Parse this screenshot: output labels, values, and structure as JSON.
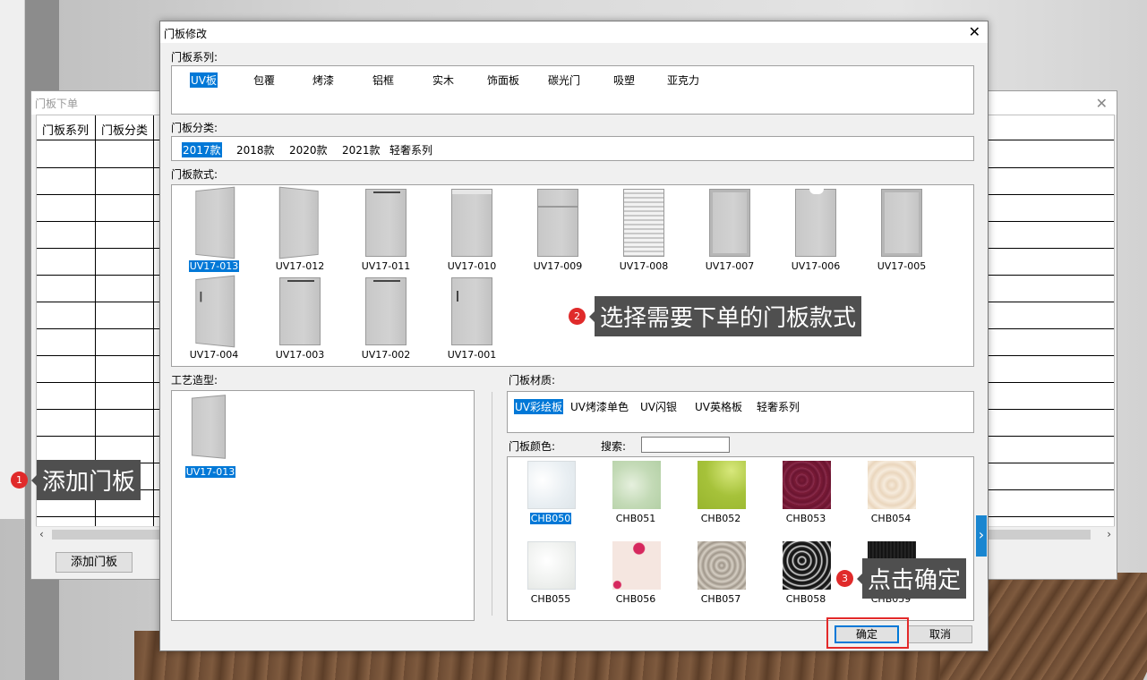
{
  "order_window": {
    "title": "门板下单",
    "columns": [
      "门板系列",
      "门板分类"
    ],
    "add_button": "添加门板"
  },
  "dialog": {
    "title": "门板修改",
    "series_label": "门板系列:",
    "series": [
      "UV板",
      "包覆",
      "烤漆",
      "铝框",
      "实木",
      "饰面板",
      "碳光门",
      "吸塑",
      "亚克力"
    ],
    "category_label": "门板分类:",
    "categories": [
      "2017款",
      "2018款",
      "2020款",
      "2021款",
      "轻奢系列"
    ],
    "style_label": "门板款式:",
    "styles": [
      "UV17-013",
      "UV17-012",
      "UV17-011",
      "UV17-010",
      "UV17-009",
      "UV17-008",
      "UV17-007",
      "UV17-006",
      "UV17-005",
      "UV17-004",
      "UV17-003",
      "UV17-002",
      "UV17-001"
    ],
    "craft_label": "工艺造型:",
    "craft_item": "UV17-013",
    "material_label": "门板材质:",
    "materials": [
      "UV彩绘板",
      "UV烤漆单色",
      "UV闪银",
      "UV英格板",
      "轻奢系列"
    ],
    "color_label": "门板颜色:",
    "search_label": "搜索:",
    "search_value": "",
    "colors": [
      "CHB050",
      "CHB051",
      "CHB052",
      "CHB053",
      "CHB054",
      "CHB055",
      "CHB056",
      "CHB057",
      "CHB058",
      "CHB059"
    ],
    "ok_button": "确定",
    "cancel_button": "取消"
  },
  "callouts": [
    {
      "num": "1",
      "text": "添加门板"
    },
    {
      "num": "2",
      "text": "选择需要下单的门板款式"
    },
    {
      "num": "3",
      "text": "点击确定"
    }
  ]
}
